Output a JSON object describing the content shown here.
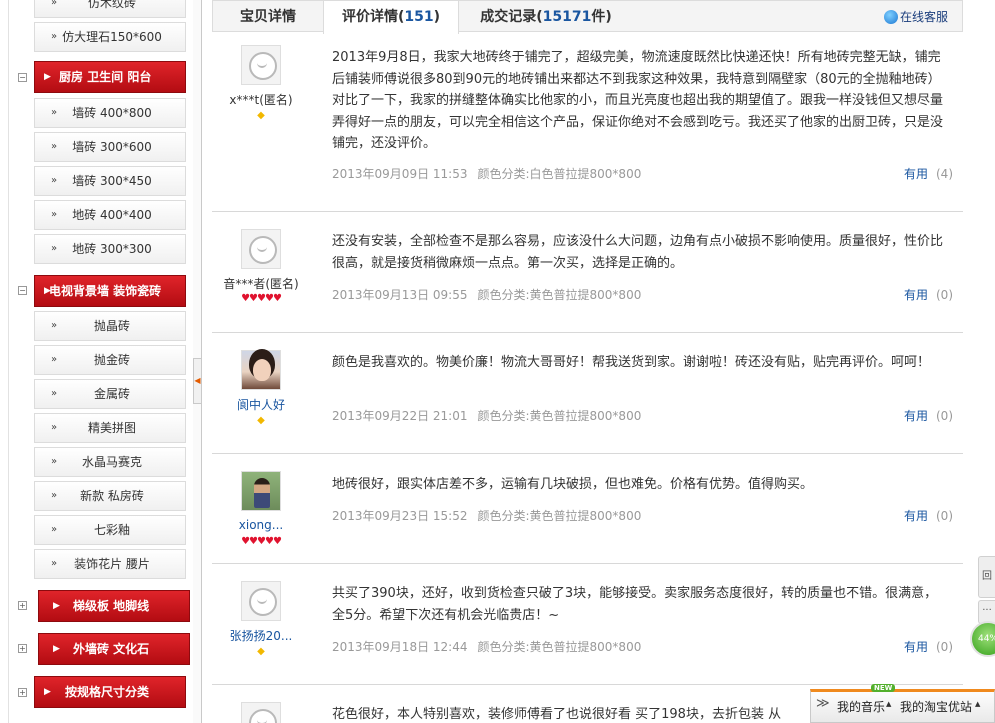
{
  "sidebar": {
    "items": [
      {
        "label": "仿木纹砖"
      },
      {
        "label": "仿大理石150*600"
      },
      {
        "label": "厨房 卫生间 阳台",
        "category": true
      },
      {
        "label": "墙砖 400*800"
      },
      {
        "label": "墙砖 300*600"
      },
      {
        "label": "墙砖 300*450"
      },
      {
        "label": "地砖 400*400"
      },
      {
        "label": "地砖 300*300"
      },
      {
        "label": "电视背景墙 装饰瓷砖",
        "category": true
      },
      {
        "label": "抛晶砖"
      },
      {
        "label": "抛金砖"
      },
      {
        "label": "金属砖"
      },
      {
        "label": "精美拼图"
      },
      {
        "label": "水晶马赛克"
      },
      {
        "label": "新款 私房砖"
      },
      {
        "label": "七彩釉"
      },
      {
        "label": "装饰花片 腰片"
      },
      {
        "label": "梯级板 地脚线",
        "category": true
      },
      {
        "label": "外墙砖 文化石",
        "category": true
      },
      {
        "label": "按规格尺寸分类",
        "category": true
      }
    ],
    "toggle_symbol": "⊟",
    "arrow_symbol": "»",
    "cat_arrow_symbol": "▶"
  },
  "tabs": {
    "detail": "宝贝详情",
    "reviews": "评价详情",
    "reviews_count": "151",
    "records": "成交记录",
    "records_count": "15171",
    "records_unit": "件",
    "service": "在线客服"
  },
  "reviews": [
    {
      "user": "x***t(匿名)",
      "badge": "◆",
      "text": "2013年9月8日，我家大地砖终于铺完了，超级完美，物流速度既然比快递还快！所有地砖完整无缺，铺完后铺装师傅说很多80到90元的地砖铺出来都达不到我家这种效果，我特意到隔壁家（80元的全抛釉地砖）对比了一下，我家的拼缝整体确实比他家的小，而且光亮度也超出我的期望值了。跟我一样没钱但又想尽量弄得好一点的朋友，可以完全相信这个产品，保证你绝对不会感到吃亏。我还买了他家的出厨卫砖，只是没铺完，还没评价。",
      "date": "2013年09月09日 11:53",
      "spec": "颜色分类:白色普拉提800*800",
      "useful_label": "有用",
      "useful_count": "(4)"
    },
    {
      "user": "音***者(匿名)",
      "badge": "♥♥♥♥♥",
      "text": "还没有安装，全部检查不是那么容易，应该没什么大问题，边角有点小破损不影响使用。质量很好，性价比很高，就是接货稍微麻烦一点点。第一次买，选择是正确的。",
      "date": "2013年09月13日 09:55",
      "spec": "颜色分类:黄色普拉提800*800",
      "useful_label": "有用",
      "useful_count": "(0)"
    },
    {
      "user": "阆中人好",
      "badge": "◆",
      "text": "颜色是我喜欢的。物美价廉！物流大哥哥好！帮我送货到家。谢谢啦！砖还没有贴，贴完再评价。呵呵！",
      "date": "2013年09月22日 21:01",
      "spec": "颜色分类:黄色普拉提800*800",
      "useful_label": "有用",
      "useful_count": "(0)"
    },
    {
      "user": "xiong...",
      "badge": "♥♥♥♥♥",
      "text": "地砖很好，跟实体店差不多，运输有几块破损，但也难免。价格有优势。值得购买。",
      "date": "2013年09月23日 15:52",
      "spec": "颜色分类:黄色普拉提800*800",
      "useful_label": "有用",
      "useful_count": "(0)"
    },
    {
      "user": "张扬扬20...",
      "badge": "◆",
      "text": "共买了390块，还好，收到货检查只破了3块，能够接受。卖家服务态度很好，转的质量也不错。很满意，全5分。希望下次还有机会光临贵店！~",
      "date": "2013年09月18日 12:44",
      "spec": "颜色分类:黄色普拉提800*800",
      "useful_label": "有用",
      "useful_count": "(0)"
    },
    {
      "text": "花色很好，本人特别喜欢，装修师傅看了也说很好看 买了198块，去折包装 从"
    }
  ],
  "right_widgets": {
    "back_label": "回",
    "chat_label": "···",
    "progress": "44%"
  },
  "bottom_bar": {
    "collapse": "≫",
    "music": "我的音乐",
    "new_badge": "NEW",
    "shop": "我的淘宝优站",
    "caret": "▲"
  }
}
